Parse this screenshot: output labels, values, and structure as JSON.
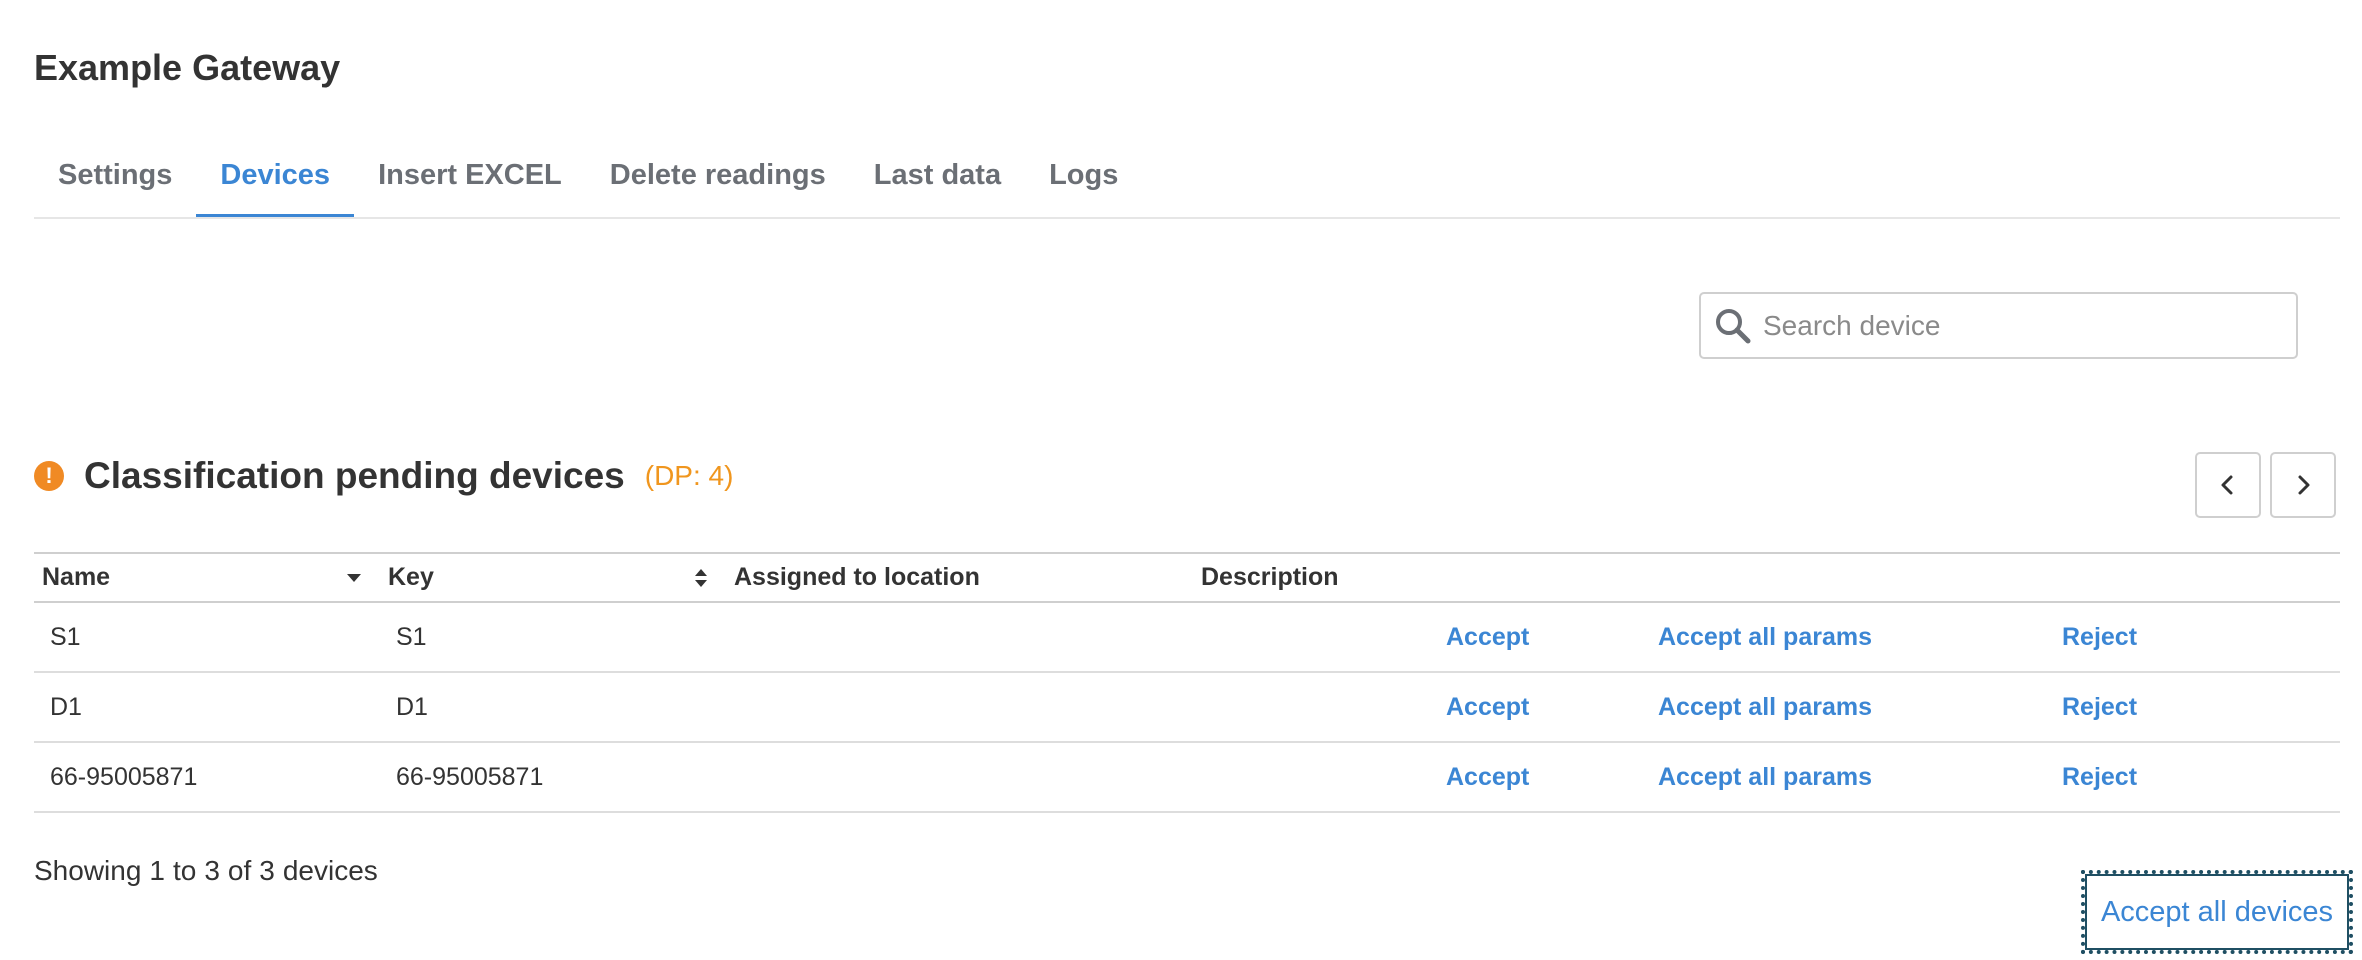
{
  "page": {
    "title": "Example Gateway"
  },
  "tabs": [
    {
      "label": "Settings",
      "active": false
    },
    {
      "label": "Devices",
      "active": true
    },
    {
      "label": "Insert EXCEL",
      "active": false
    },
    {
      "label": "Delete readings",
      "active": false
    },
    {
      "label": "Last data",
      "active": false
    },
    {
      "label": "Logs",
      "active": false
    }
  ],
  "search": {
    "placeholder": "Search device",
    "value": "",
    "icon": "search-icon"
  },
  "section": {
    "icon": "warning-icon",
    "icon_glyph": "!",
    "title": "Classification pending devices",
    "count_label": "(DP: 4)"
  },
  "pager": {
    "prev_icon": "chevron-left-icon",
    "next_icon": "chevron-right-icon"
  },
  "table": {
    "columns": [
      "Name",
      "Key",
      "Assigned to location",
      "Description"
    ],
    "rows": [
      {
        "name": "S1",
        "key": "S1",
        "location": "",
        "description": "",
        "accept": "Accept",
        "accept_all_params": "Accept all params",
        "reject": "Reject"
      },
      {
        "name": "D1",
        "key": "D1",
        "location": "",
        "description": "",
        "accept": "Accept",
        "accept_all_params": "Accept all params",
        "reject": "Reject"
      },
      {
        "name": "66-95005871",
        "key": "66-95005871",
        "location": "",
        "description": "",
        "accept": "Accept",
        "accept_all_params": "Accept all params",
        "reject": "Reject"
      }
    ]
  },
  "footer": {
    "showing_prefix": "Showing",
    "from": "1",
    "to_word": "to",
    "to": "3",
    "of_word": "of",
    "total": "3",
    "suffix": "devices",
    "accept_all_label": "Accept all devices"
  },
  "colors": {
    "accent": "#3b86d4",
    "warning": "#f08a24",
    "count": "#f0961e",
    "text": "#333333"
  }
}
